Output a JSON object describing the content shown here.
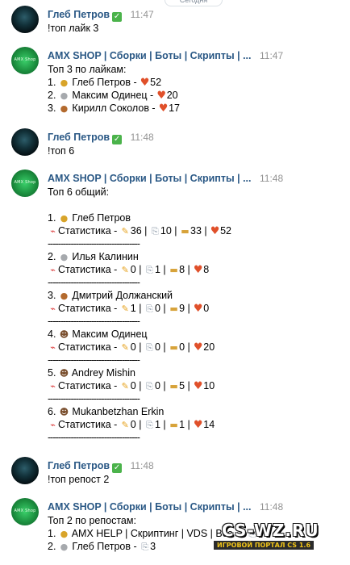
{
  "date_pill": "Сегодня",
  "messages": [
    {
      "author": "Глеб Петров",
      "time": "11:47",
      "lines": [
        "!топ лайк 3"
      ]
    },
    {
      "author": "AMX SHOP | Сборки | Боты | Скрипты | ...",
      "time": "11:47",
      "title": "Топ 3 по лайкам:",
      "items": [
        {
          "num": "1.",
          "name": "Глеб Петров -",
          "value": "52"
        },
        {
          "num": "2.",
          "name": "Максим Одинец -",
          "value": "20"
        },
        {
          "num": "3.",
          "name": "Кирилл Соколов -",
          "value": "17"
        }
      ]
    },
    {
      "author": "Глеб Петров",
      "time": "11:48",
      "lines": [
        "!топ 6"
      ]
    },
    {
      "author": "AMX SHOP | Сборки | Боты | Скрипты | ...",
      "time": "11:48",
      "title": "Топ 6 общий:",
      "stat_label": "Статистика -",
      "entries": [
        {
          "num": "1.",
          "name": "Глеб Петров",
          "stats": [
            "36",
            "10",
            "33",
            "52"
          ]
        },
        {
          "num": "2.",
          "name": "Илья Калинин",
          "stats": [
            "0",
            "1",
            "8",
            "8"
          ]
        },
        {
          "num": "3.",
          "name": "Дмитрий Должанский",
          "stats": [
            "1",
            "0",
            "9",
            "0"
          ]
        },
        {
          "num": "4.",
          "name": "Максим Одинец",
          "stats": [
            "0",
            "0",
            "0",
            "20"
          ]
        },
        {
          "num": "5.",
          "name": "Andrey Mishin",
          "stats": [
            "0",
            "0",
            "5",
            "10"
          ]
        },
        {
          "num": "6.",
          "name": "Mukanbetzhan Erkin",
          "stats": [
            "0",
            "1",
            "1",
            "14"
          ]
        }
      ],
      "separator": "------------------------------------"
    },
    {
      "author": "Глеб Петров",
      "time": "11:48",
      "lines": [
        "!топ репост 2"
      ]
    },
    {
      "author": "AMX SHOP | Сборки | Боты | Скрипты | ...",
      "time": "11:48",
      "title": "Топ 2 по репостам:",
      "items": [
        {
          "num": "1.",
          "name": "AMX HELP | Скриптинг | VDS | Все ...",
          "value": "3"
        },
        {
          "num": "2.",
          "name": "Глеб Петров -",
          "value": "3"
        }
      ]
    }
  ],
  "avatar_text": "AMX Shop",
  "verified_icon": "check",
  "watermark": {
    "main": "CS-WZ.RU",
    "sub": "ИГРОВОЙ ПОРТАЛ CS 1.6"
  }
}
